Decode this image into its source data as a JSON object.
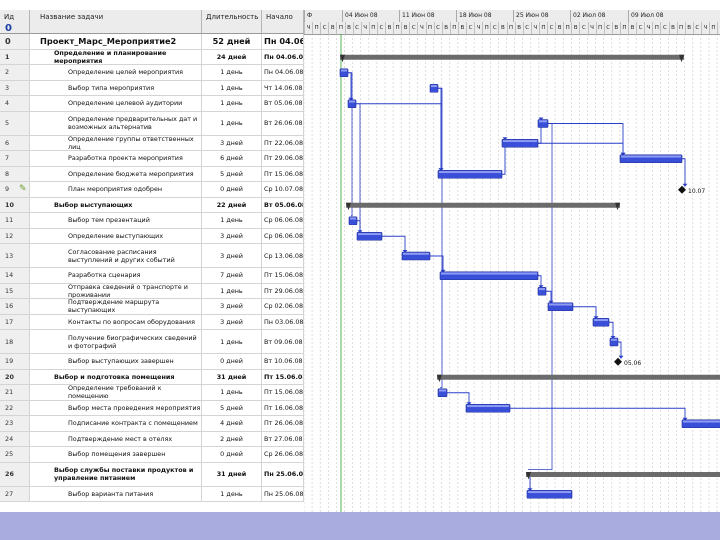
{
  "table": {
    "headers": {
      "id": "Ид",
      "name": "Название задачи",
      "duration": "Длительность",
      "start": "Начало"
    },
    "corner_icon": "info-icon",
    "rows": [
      {
        "id": "0",
        "name": "Проект_Марс_Мероприятие2",
        "duration": "52 дней",
        "start": "Пн 04.06.08",
        "level": 0,
        "type": "project"
      },
      {
        "id": "1",
        "name": "Определение и планирование мероприятия",
        "duration": "24 дней",
        "start": "Пн 04.06.08",
        "level": 1,
        "type": "summary"
      },
      {
        "id": "2",
        "name": "Определение целей мероприятия",
        "duration": "1 день",
        "start": "Пн 04.06.08",
        "level": 2,
        "type": "task"
      },
      {
        "id": "3",
        "name": "Выбор типа мероприятия",
        "duration": "1 день",
        "start": "Чт 14.06.08",
        "level": 2,
        "type": "task"
      },
      {
        "id": "4",
        "name": "Определение целевой аудитории",
        "duration": "1 день",
        "start": "Вт 05.06.08",
        "level": 2,
        "type": "task"
      },
      {
        "id": "5",
        "name": "Определение предварительных дат и возможных альтернатив",
        "duration": "1 день",
        "start": "Вт 26.06.08",
        "level": 2,
        "type": "task",
        "tall": true
      },
      {
        "id": "6",
        "name": "Определение группы ответственных лиц",
        "duration": "3 дней",
        "start": "Пт 22.06.08",
        "level": 2,
        "type": "task"
      },
      {
        "id": "7",
        "name": "Разработка проекта мероприятия",
        "duration": "6 дней",
        "start": "Пт 29.06.08",
        "level": 2,
        "type": "task"
      },
      {
        "id": "8",
        "name": "Определение бюджета мероприятия",
        "duration": "5 дней",
        "start": "Пт 15.06.08",
        "level": 2,
        "type": "task"
      },
      {
        "id": "9",
        "name": "План мероприятия одобрен",
        "duration": "0 дней",
        "start": "Ср 10.07.08",
        "level": 2,
        "type": "task",
        "indicator": true
      },
      {
        "id": "10",
        "name": "Выбор выступающих",
        "duration": "22 дней",
        "start": "Вт 05.06.08",
        "level": 1,
        "type": "summary"
      },
      {
        "id": "11",
        "name": "Выбор тем презентаций",
        "duration": "1 день",
        "start": "Ср 06.06.08",
        "level": 2,
        "type": "task"
      },
      {
        "id": "12",
        "name": "Определение выступающих",
        "duration": "3 дней",
        "start": "Ср 06.06.08",
        "level": 2,
        "type": "task"
      },
      {
        "id": "13",
        "name": "Согласование расписания выступлений и других событий",
        "duration": "3 дней",
        "start": "Ср 13.06.08",
        "level": 2,
        "type": "task",
        "tall": true
      },
      {
        "id": "14",
        "name": "Разработка сценария",
        "duration": "7 дней",
        "start": "Пт 15.06.08",
        "level": 2,
        "type": "task"
      },
      {
        "id": "15",
        "name": "Отправка сведений о транспорте и проживании",
        "duration": "1 день",
        "start": "Пт 29.06.08",
        "level": 2,
        "type": "task"
      },
      {
        "id": "16",
        "name": "Подтверждение маршрута выступающих",
        "duration": "3 дней",
        "start": "Ср 02.06.08",
        "level": 2,
        "type": "task"
      },
      {
        "id": "17",
        "name": "Контакты по вопросам оборудования",
        "duration": "3 дней",
        "start": "Пн 03.06.08",
        "level": 2,
        "type": "task"
      },
      {
        "id": "18",
        "name": "Получение биографических сведений и фотографий",
        "duration": "1 день",
        "start": "Вт 09.06.08",
        "level": 2,
        "type": "task",
        "tall": true
      },
      {
        "id": "19",
        "name": "Выбор выступающих завершен",
        "duration": "0 дней",
        "start": "Вт 10.06.08",
        "level": 2,
        "type": "task"
      },
      {
        "id": "20",
        "name": "Выбор и подготовка помещения",
        "duration": "31 дней",
        "start": "Пт 15.06.08",
        "level": 1,
        "type": "summary"
      },
      {
        "id": "21",
        "name": "Определение требований к помещению",
        "duration": "1 день",
        "start": "Пт 15.06.08",
        "level": 2,
        "type": "task"
      },
      {
        "id": "22",
        "name": "Выбор места проведения мероприятия",
        "duration": "5 дней",
        "start": "Пт 16.06.08",
        "level": 2,
        "type": "task"
      },
      {
        "id": "23",
        "name": "Подписание контракта с помещением",
        "duration": "4 дней",
        "start": "Пт 26.06.08",
        "level": 2,
        "type": "task"
      },
      {
        "id": "24",
        "name": "Подтверждение мест в отелях",
        "duration": "2 дней",
        "start": "Вт 27.06.08",
        "level": 2,
        "type": "task"
      },
      {
        "id": "25",
        "name": "Выбор помещения завершен",
        "duration": "0 дней",
        "start": "Ср 26.06.08",
        "level": 2,
        "type": "task"
      },
      {
        "id": "26",
        "name": "Выбор службы поставки продуктов и управление питанием",
        "duration": "31 дней",
        "start": "Пн 25.06.08",
        "level": 1,
        "type": "summary",
        "tall": true
      },
      {
        "id": "27",
        "name": "Выбор варианта питания",
        "duration": "1 день",
        "start": "Пн 25.06.08",
        "level": 2,
        "type": "task"
      }
    ]
  },
  "gantt": {
    "weeks": [
      "Ф",
      "04 Июн 08",
      "11 Июн 08",
      "18 Июн 08",
      "25 Июн 08",
      "02 Июл 08",
      "09 Июл 08"
    ],
    "day_letters": [
      "Ч",
      "П",
      "С",
      "В",
      "П",
      "В",
      "С",
      "Ч",
      "П",
      "С",
      "В",
      "П",
      "В",
      "С",
      "Ч",
      "П",
      "С",
      "В",
      "П",
      "В",
      "С",
      "Ч",
      "П",
      "С",
      "В",
      "П",
      "В",
      "С",
      "Ч",
      "П",
      "С",
      "В",
      "П",
      "В",
      "С",
      "Ч",
      "П",
      "С",
      "В",
      "П",
      "В",
      "С",
      "Ч",
      "П",
      "С",
      "В",
      "П",
      "В",
      "С",
      "Ч",
      "П",
      "С"
    ],
    "milestone_labels": {
      "row9": "10.07",
      "row19": "05.06"
    },
    "colors": {
      "task_bar": "#3a4fd8",
      "summary_bar": "#6b6b6b",
      "link": "#2b3fc8",
      "current_day": "#2aa02a",
      "grid": "#c8c8c8"
    }
  },
  "colors": {
    "bottom_strip": "#a9acde",
    "header_bg": "#ececec"
  }
}
